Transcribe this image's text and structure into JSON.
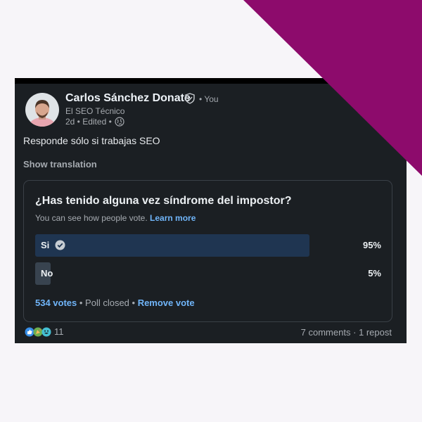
{
  "post": {
    "author_name": "Carlos Sánchez Donate",
    "you_tag": "• You",
    "headline": "El SEO Técnico",
    "time_edited": "2d • Edited •",
    "body": "Responde sólo si trabajas SEO",
    "show_translation": "Show translation"
  },
  "poll": {
    "question": "¿Has tenido alguna vez síndrome del impostor?",
    "note": "You can see how people vote.",
    "learn_more": "Learn more",
    "options": [
      {
        "label": "Si",
        "percent_text": "95%",
        "share": 0.95,
        "selected": true
      },
      {
        "label": "No",
        "percent_text": "5%",
        "share": 0.05,
        "selected": false
      }
    ],
    "votes": "534 votes",
    "status": " • Poll closed • ",
    "remove_vote": "Remove vote"
  },
  "social": {
    "reaction_icons": [
      "like-icon",
      "celebrate-icon",
      "funny-icon"
    ],
    "reaction_count": "11",
    "comments": "7 comments",
    "separator": " · ",
    "reposts": "1 repost"
  },
  "colors": {
    "accent_magenta": "#8d0b6c",
    "link_blue": "#70b5f9",
    "selected_bar": "#1f3551",
    "unselected_bar": "#38434f"
  }
}
